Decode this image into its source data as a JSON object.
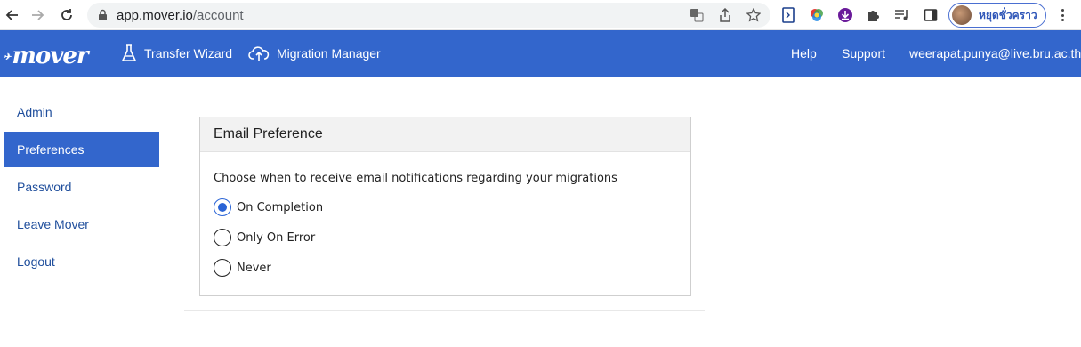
{
  "browser": {
    "url_host": "app.mover.io",
    "url_path": "/account",
    "profile_name": "หยุดชั่วคราว"
  },
  "header": {
    "logo": "mover",
    "nav": [
      {
        "label": "Transfer Wizard",
        "icon": "flask-icon"
      },
      {
        "label": "Migration Manager",
        "icon": "cloud-upload-icon"
      }
    ],
    "links": {
      "help": "Help",
      "support": "Support",
      "user": "weerapat.punya@live.bru.ac.th"
    }
  },
  "sidebar": {
    "items": [
      {
        "label": "Admin",
        "active": false
      },
      {
        "label": "Preferences",
        "active": true
      },
      {
        "label": "Password",
        "active": false
      },
      {
        "label": "Leave Mover",
        "active": false
      },
      {
        "label": "Logout",
        "active": false
      }
    ]
  },
  "panel": {
    "title": "Email Preference",
    "description": "Choose when to receive email notifications regarding your migrations",
    "options": [
      {
        "label": "On Completion",
        "checked": true
      },
      {
        "label": "Only On Error",
        "checked": false
      },
      {
        "label": "Never",
        "checked": false
      }
    ]
  },
  "colors": {
    "brand": "#3366cc",
    "radio_accent": "#2a64d6"
  }
}
